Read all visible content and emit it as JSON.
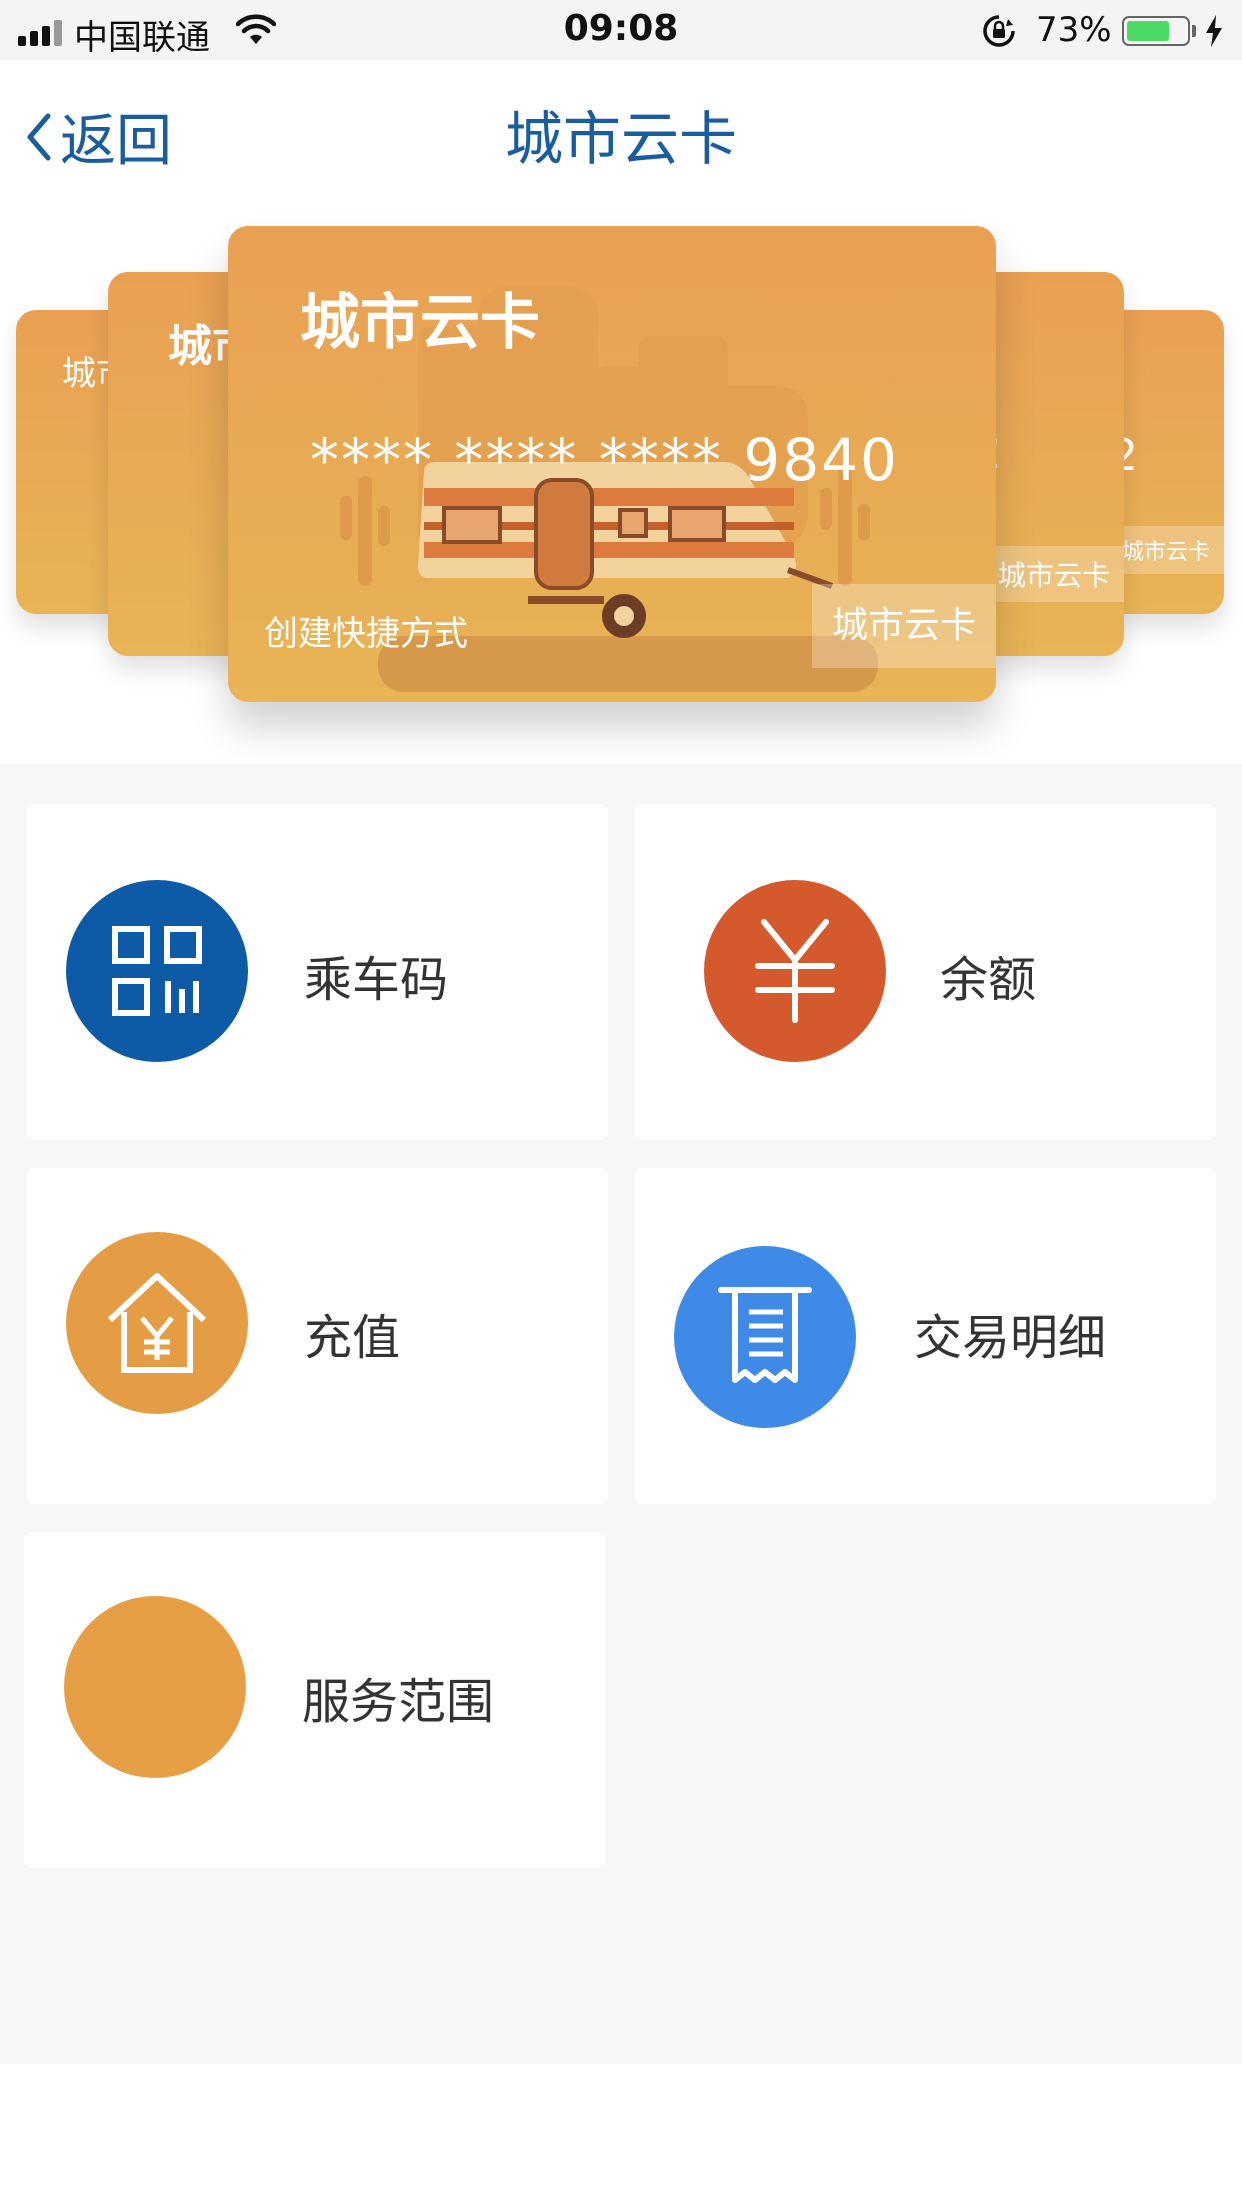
{
  "status_bar": {
    "carrier": "中国联通",
    "time": "09:08",
    "battery_percent": "73%",
    "battery_level": 0.73
  },
  "nav": {
    "back_label": "返回",
    "title": "城市云卡"
  },
  "cards": {
    "main": {
      "title": "城市云卡",
      "number": "****  ****  **** 9840",
      "shortcut_label": "创建快捷方式",
      "tag": "城市云卡"
    },
    "side_left_1": {
      "title": "城市云卡"
    },
    "side_left_2": {
      "title": "城市云卡"
    },
    "side_right_1": {
      "digit": "2",
      "tag": "城市云卡"
    },
    "side_right_2": {
      "digit": "2",
      "tag": "城市云卡"
    }
  },
  "menu": {
    "ride_code": {
      "label": "乘车码",
      "color": "#0d5aa7",
      "icon": "qr-code-icon"
    },
    "balance": {
      "label": "余额",
      "color": "#d45a2e",
      "icon": "yuan-icon"
    },
    "recharge": {
      "label": "充值",
      "color": "#e59d45",
      "icon": "house-yuan-icon"
    },
    "transactions": {
      "label": "交易明细",
      "color": "#3f8ae6",
      "icon": "receipt-icon"
    },
    "service_area": {
      "label": "服务范围",
      "color": "#e69f45",
      "icon": "blank-circle-icon"
    }
  }
}
